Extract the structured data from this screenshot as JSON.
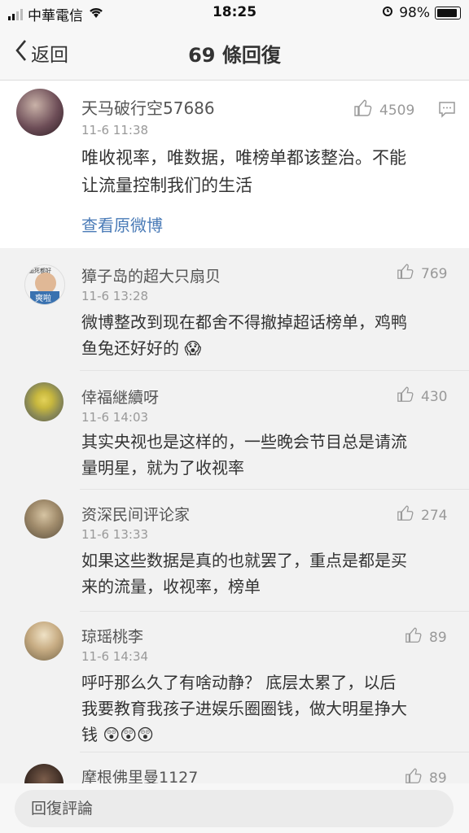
{
  "status": {
    "carrier": "中華電信",
    "time": "18:25",
    "battery": "98%"
  },
  "nav": {
    "back_label": "返回",
    "title": "69 條回復"
  },
  "main_post": {
    "author": "天马破行空57686",
    "time": "11-6 11:38",
    "likes": "4509",
    "text_line1": "唯收视率，唯数据，唯榜单都该整治。不能",
    "text_line2": "让流量控制我们的生活",
    "view_original": "查看原微博"
  },
  "comments": [
    {
      "author": "獐子岛的超大只扇贝",
      "time": "11-6 13:28",
      "likes": "769",
      "line1": "微博整改到现在都舍不得撤掉超话榜单，鸡鸭",
      "line2": "鱼兔还好好的 😱",
      "line3": ""
    },
    {
      "author": "倖福継續呀",
      "time": "11-6 14:03",
      "likes": "430",
      "line1": "其实央视也是这样的，一些晚会节目总是请流",
      "line2": "量明星，就为了收视率",
      "line3": ""
    },
    {
      "author": "资深民间评论家",
      "time": "11-6 13:33",
      "likes": "274",
      "line1": "如果这些数据是真的也就罢了，重点是都是买",
      "line2": "来的流量，收视率，榜单",
      "line3": ""
    },
    {
      "author": "琼瑶桃李",
      "time": "11-6 14:34",
      "likes": "89",
      "line1": "呼吁那么久了有啥动静？ 底层太累了，以后",
      "line2": "我要教育我孩子进娱乐圈圈钱，做大明星挣大",
      "line3": "钱 😲😲😲"
    },
    {
      "author": "摩根佛里曼1127",
      "time": "",
      "likes": "89",
      "line1": "",
      "line2": "",
      "line3": ""
    }
  ],
  "avatar_badge": {
    "line1": "画死都好",
    "line2": "爽啦"
  },
  "reply": {
    "placeholder": "回復評論"
  },
  "colors": {
    "link": "#4a7bb7",
    "background": "#f2f2f2",
    "card": "#ffffff"
  }
}
